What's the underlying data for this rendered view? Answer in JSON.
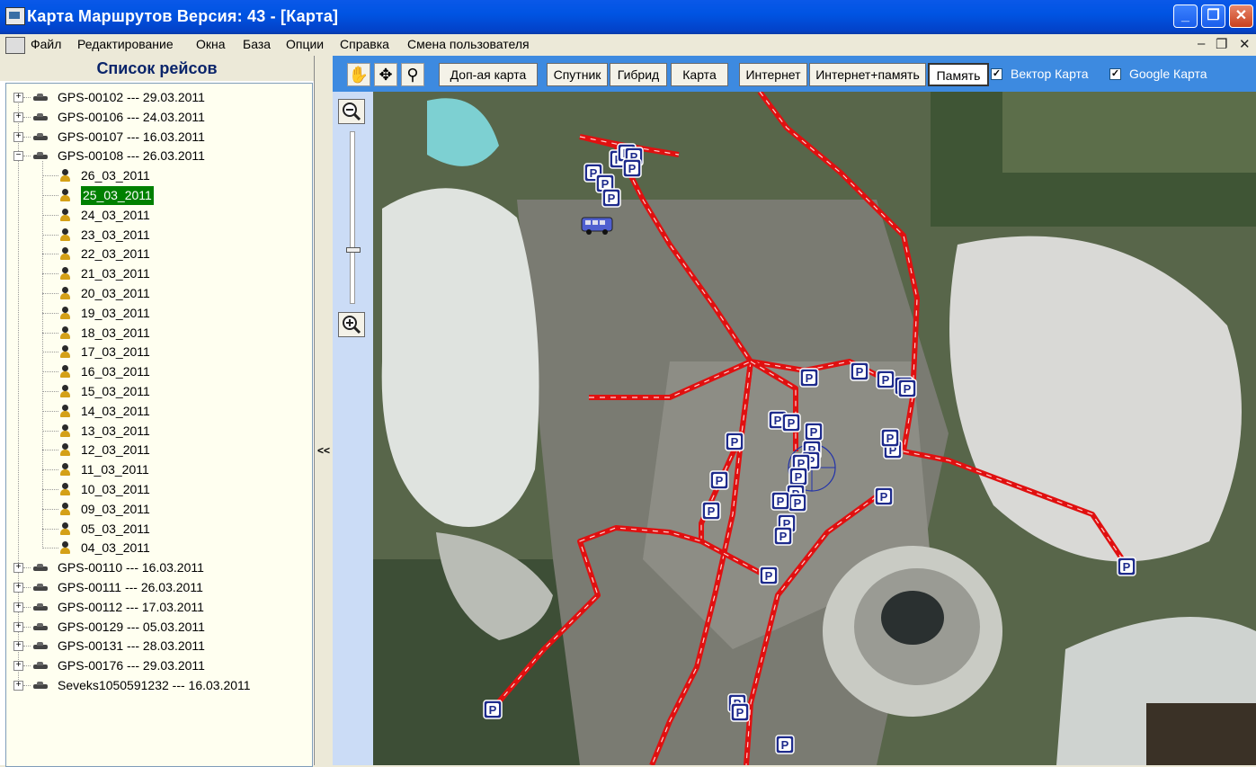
{
  "window": {
    "title": "Карта Маршрутов Версия: 43 - [Карта]"
  },
  "menu": {
    "items": [
      "Файл",
      "Редактирование",
      "Окна",
      "База",
      "Опции",
      "Справка",
      "Смена пользователя"
    ]
  },
  "panel": {
    "title": "Список рейсов"
  },
  "tree": {
    "vehicles_top": [
      {
        "label": "GPS-00102 --- 29.03.2011",
        "expanded": false
      },
      {
        "label": "GPS-00106 --- 24.03.2011",
        "expanded": false
      },
      {
        "label": "GPS-00107 --- 16.03.2011",
        "expanded": false
      },
      {
        "label": "GPS-00108 --- 26.03.2011",
        "expanded": true
      }
    ],
    "days": [
      "26_03_2011",
      "25_03_2011",
      "24_03_2011",
      "23_03_2011",
      "22_03_2011",
      "21_03_2011",
      "20_03_2011",
      "19_03_2011",
      "18_03_2011",
      "17_03_2011",
      "16_03_2011",
      "15_03_2011",
      "14_03_2011",
      "13_03_2011",
      "12_03_2011",
      "11_03_2011",
      "10_03_2011",
      "09_03_2011",
      "05_03_2011",
      "04_03_2011"
    ],
    "selected_day": "25_03_2011",
    "vehicles_bottom": [
      "GPS-00110 --- 16.03.2011",
      "GPS-00111 --- 26.03.2011",
      "GPS-00112 --- 17.03.2011",
      "GPS-00129 --- 05.03.2011",
      "GPS-00131 --- 28.03.2011",
      "GPS-00176 --- 29.03.2011",
      "Seveks1050591232 --- 16.03.2011"
    ]
  },
  "splitter": {
    "label": "<<"
  },
  "toolbar": {
    "tools": [
      {
        "icon": "hand-icon",
        "glyph": "✋"
      },
      {
        "icon": "move-icon",
        "glyph": "✥"
      },
      {
        "icon": "magnifier-icon",
        "glyph": "🔍"
      }
    ],
    "buttons": [
      "Доп-ая карта",
      "Спутник",
      "Гибрид",
      "Карта",
      "Интернет",
      "Интернет+память",
      "Память"
    ],
    "pressed": "Память",
    "checkboxes": [
      {
        "label": "Вектор Карта",
        "checked": true
      },
      {
        "label": "Google Карта",
        "checked": true
      }
    ]
  },
  "zoom": {
    "level_fraction": 0.69
  },
  "map": {
    "parking_label": "P",
    "marker_icon": "parking-marker-icon",
    "vehicle_icon": "bus-icon",
    "route_color": "#E01010"
  }
}
